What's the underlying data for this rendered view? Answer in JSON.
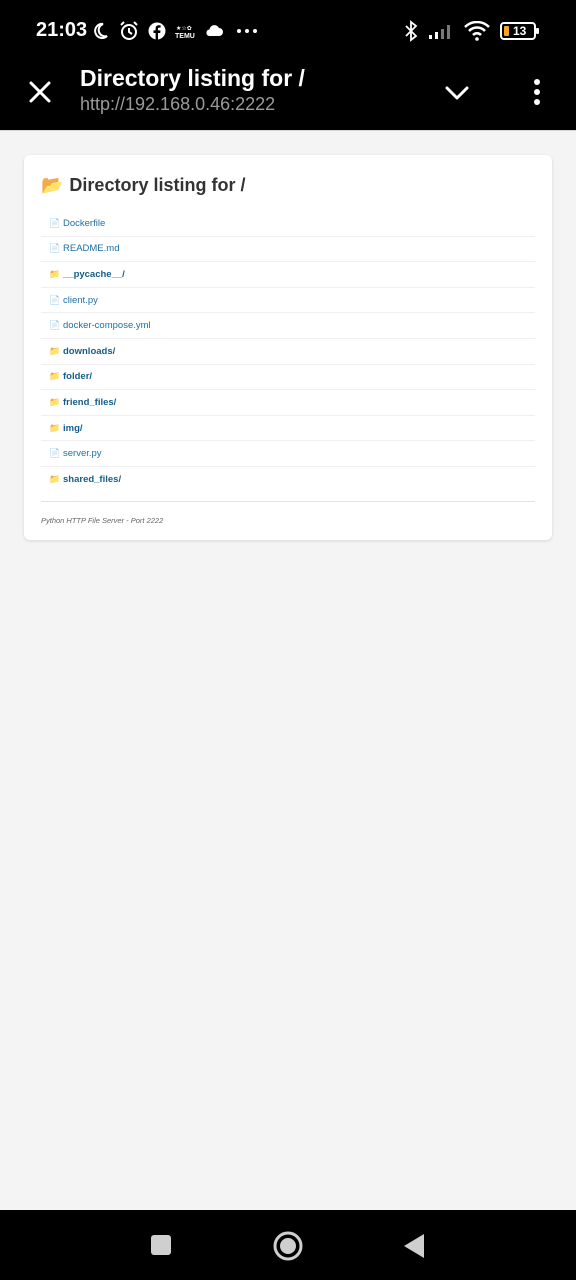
{
  "status_bar": {
    "time": "21:03",
    "battery": "13",
    "left_icons": [
      "moon-icon",
      "alarm-icon",
      "facebook-icon",
      "temu-icon",
      "cloud-icon",
      "more-dots-icon"
    ],
    "right_icons": [
      "bluetooth-icon",
      "signal-icon",
      "wifi-icon",
      "battery-icon"
    ]
  },
  "app_bar": {
    "title": "Directory listing for /",
    "url": "http://192.168.0.46:2222"
  },
  "page": {
    "heading_emoji": "📂",
    "heading": "Directory listing for /",
    "files": [
      {
        "name": "Dockerfile",
        "type": "file"
      },
      {
        "name": "README.md",
        "type": "file"
      },
      {
        "name": "__pycache__/",
        "type": "dir"
      },
      {
        "name": "client.py",
        "type": "file"
      },
      {
        "name": "docker-compose.yml",
        "type": "file"
      },
      {
        "name": "downloads/",
        "type": "dir"
      },
      {
        "name": "folder/",
        "type": "dir"
      },
      {
        "name": "friend_files/",
        "type": "dir"
      },
      {
        "name": "img/",
        "type": "dir"
      },
      {
        "name": "server.py",
        "type": "file"
      },
      {
        "name": "shared_files/",
        "type": "dir"
      }
    ],
    "footer": "Python HTTP File Server - Port 2222"
  },
  "colors": {
    "link": "#1d6fa5",
    "dir_link": "#135e8c",
    "folder": "#e9b22c"
  }
}
